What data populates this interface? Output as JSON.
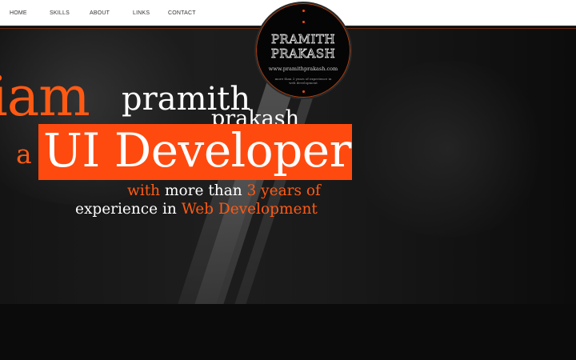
{
  "nav": {
    "items": [
      "HOME",
      "SKILLS",
      "ABOUT",
      "LINKS",
      "CONTACT"
    ]
  },
  "logo": {
    "line1": "PRAMITH",
    "line2": "PRAKASH",
    "url": "www.pramithprakash.com",
    "tagline": "more than 3 years of experience in web development"
  },
  "hero": {
    "iam": "iam",
    "first_name": "pramith",
    "last_name": "prakash",
    "article": "a",
    "role": "UI Developer",
    "line1_with": "with",
    "line1_more": " more than ",
    "line1_years": "3 years of",
    "line2_exp": "experience in ",
    "line2_field": "Web Development"
  },
  "colors": {
    "accent": "#ff4a0f",
    "nav_bg": "#ffffff",
    "background": "#080808"
  }
}
